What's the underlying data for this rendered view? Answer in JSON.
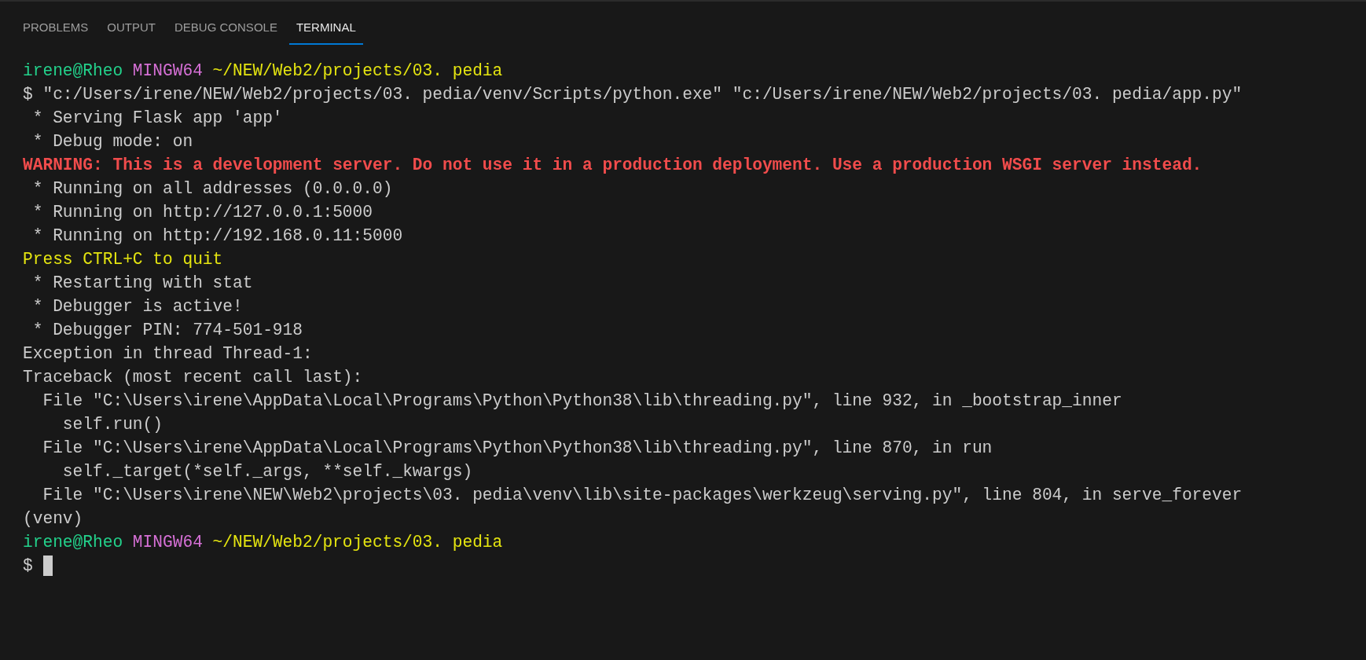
{
  "tabs": [
    {
      "label": "PROBLEMS",
      "selected": false
    },
    {
      "label": "OUTPUT",
      "selected": false
    },
    {
      "label": "DEBUG CONSOLE",
      "selected": false
    },
    {
      "label": "TERMINAL",
      "selected": true
    }
  ],
  "terminal": {
    "lines": [
      {
        "kind": "prompt",
        "user": "irene@Rheo",
        "system": "MINGW64",
        "path": "~/NEW/Web2/projects/03. pedia"
      },
      {
        "kind": "plain",
        "text": "$ \"c:/Users/irene/NEW/Web2/projects/03. pedia/venv/Scripts/python.exe\" \"c:/Users/irene/NEW/Web2/projects/03. pedia/app.py\""
      },
      {
        "kind": "plain",
        "text": " * Serving Flask app 'app'"
      },
      {
        "kind": "plain",
        "text": " * Debug mode: on"
      },
      {
        "kind": "warning",
        "text": "WARNING: This is a development server. Do not use it in a production deployment. Use a production WSGI server instead."
      },
      {
        "kind": "plain",
        "text": " * Running on all addresses (0.0.0.0)"
      },
      {
        "kind": "plain",
        "text": " * Running on http://127.0.0.1:5000"
      },
      {
        "kind": "plain",
        "text": " * Running on http://192.168.0.11:5000"
      },
      {
        "kind": "notice",
        "text": "Press CTRL+C to quit"
      },
      {
        "kind": "plain",
        "text": " * Restarting with stat"
      },
      {
        "kind": "plain",
        "text": " * Debugger is active!"
      },
      {
        "kind": "plain",
        "text": " * Debugger PIN: 774-501-918"
      },
      {
        "kind": "plain",
        "text": "Exception in thread Thread-1:"
      },
      {
        "kind": "plain",
        "text": "Traceback (most recent call last):"
      },
      {
        "kind": "plain",
        "text": "  File \"C:\\Users\\irene\\AppData\\Local\\Programs\\Python\\Python38\\lib\\threading.py\", line 932, in _bootstrap_inner"
      },
      {
        "kind": "plain",
        "text": "    self.run()"
      },
      {
        "kind": "plain",
        "text": "  File \"C:\\Users\\irene\\AppData\\Local\\Programs\\Python\\Python38\\lib\\threading.py\", line 870, in run"
      },
      {
        "kind": "plain",
        "text": "    self._target(*self._args, **self._kwargs)"
      },
      {
        "kind": "plain",
        "text": "  File \"C:\\Users\\irene\\NEW\\Web2\\projects\\03. pedia\\venv\\lib\\site-packages\\werkzeug\\serving.py\", line 804, in serve_forever"
      },
      {
        "kind": "plain",
        "text": "(venv)"
      },
      {
        "kind": "prompt",
        "user": "irene@Rheo",
        "system": "MINGW64",
        "path": "~/NEW/Web2/projects/03. pedia"
      },
      {
        "kind": "input",
        "text": "$"
      }
    ]
  }
}
